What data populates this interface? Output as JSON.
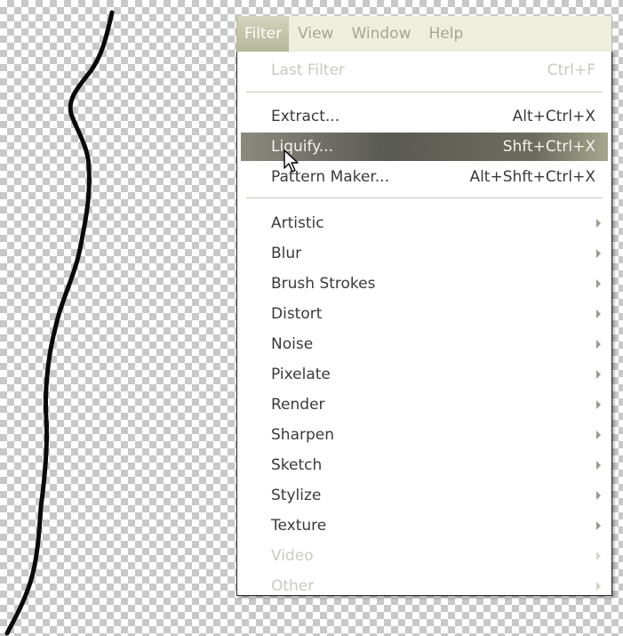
{
  "menubar": {
    "items": [
      {
        "label": "Filter",
        "active": true
      },
      {
        "label": "View",
        "active": false
      },
      {
        "label": "Window",
        "active": false
      },
      {
        "label": "Help",
        "active": false
      }
    ]
  },
  "filter_menu": {
    "last_filter": {
      "label": "Last Filter",
      "shortcut": "Ctrl+F",
      "enabled": false
    },
    "tools": [
      {
        "label": "Extract...",
        "shortcut": "Alt+Ctrl+X",
        "highlighted": false
      },
      {
        "label": "Liquify...",
        "shortcut": "Shft+Ctrl+X",
        "highlighted": true
      },
      {
        "label": "Pattern Maker...",
        "shortcut": "Alt+Shft+Ctrl+X",
        "highlighted": false
      }
    ],
    "submenus": [
      {
        "label": "Artistic",
        "enabled": true
      },
      {
        "label": "Blur",
        "enabled": true
      },
      {
        "label": "Brush Strokes",
        "enabled": true
      },
      {
        "label": "Distort",
        "enabled": true
      },
      {
        "label": "Noise",
        "enabled": true
      },
      {
        "label": "Pixelate",
        "enabled": true
      },
      {
        "label": "Render",
        "enabled": true
      },
      {
        "label": "Sharpen",
        "enabled": true
      },
      {
        "label": "Sketch",
        "enabled": true
      },
      {
        "label": "Stylize",
        "enabled": true
      },
      {
        "label": "Texture",
        "enabled": true
      },
      {
        "label": "Video",
        "enabled": false
      },
      {
        "label": "Other",
        "enabled": false
      }
    ]
  },
  "colors": {
    "menubar_bg": "#eeeedc",
    "highlight": "#5a5a54",
    "checker": "#c8c8c8"
  }
}
